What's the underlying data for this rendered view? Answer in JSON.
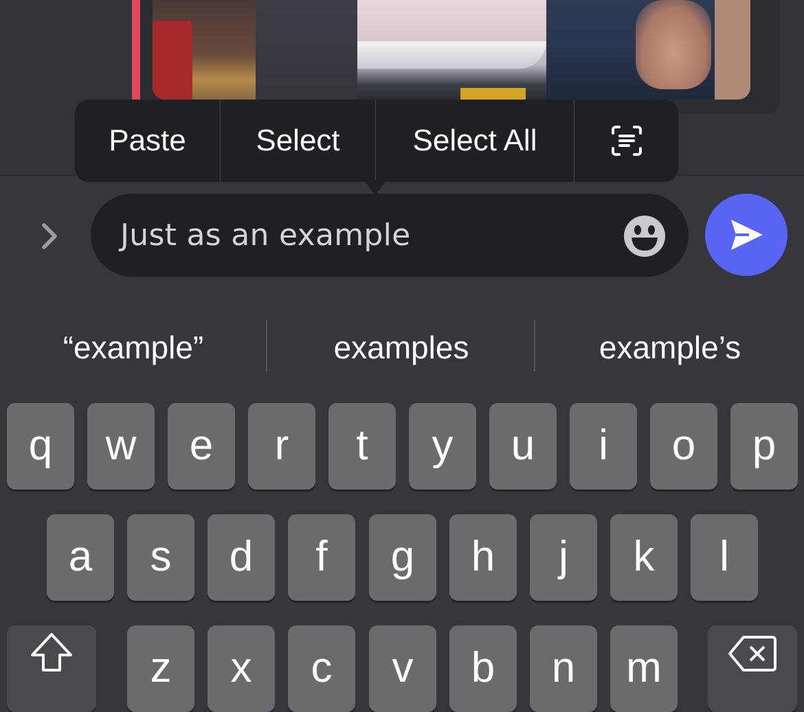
{
  "context_menu": {
    "items": [
      "Paste",
      "Select",
      "Select All"
    ],
    "scan_icon": "scan-text-icon"
  },
  "composer": {
    "expand_icon": "chevron-right-icon",
    "text": "Just as an example",
    "emoji_icon": "emoji-smile-icon",
    "send_icon": "send-arrow-icon",
    "send_color": "#5865f2"
  },
  "suggestions": [
    "“example”",
    "examples",
    "example’s"
  ],
  "keyboard": {
    "row1": [
      "q",
      "w",
      "e",
      "r",
      "t",
      "y",
      "u",
      "i",
      "o",
      "p"
    ],
    "row2": [
      "a",
      "s",
      "d",
      "f",
      "g",
      "h",
      "j",
      "k",
      "l"
    ],
    "row3": [
      "z",
      "x",
      "c",
      "v",
      "b",
      "n",
      "m"
    ],
    "shift_icon": "shift-arrow-icon",
    "delete_icon": "backspace-icon"
  },
  "accent_colors": {
    "embed_bar": "#e0465e",
    "send": "#5865f2"
  }
}
